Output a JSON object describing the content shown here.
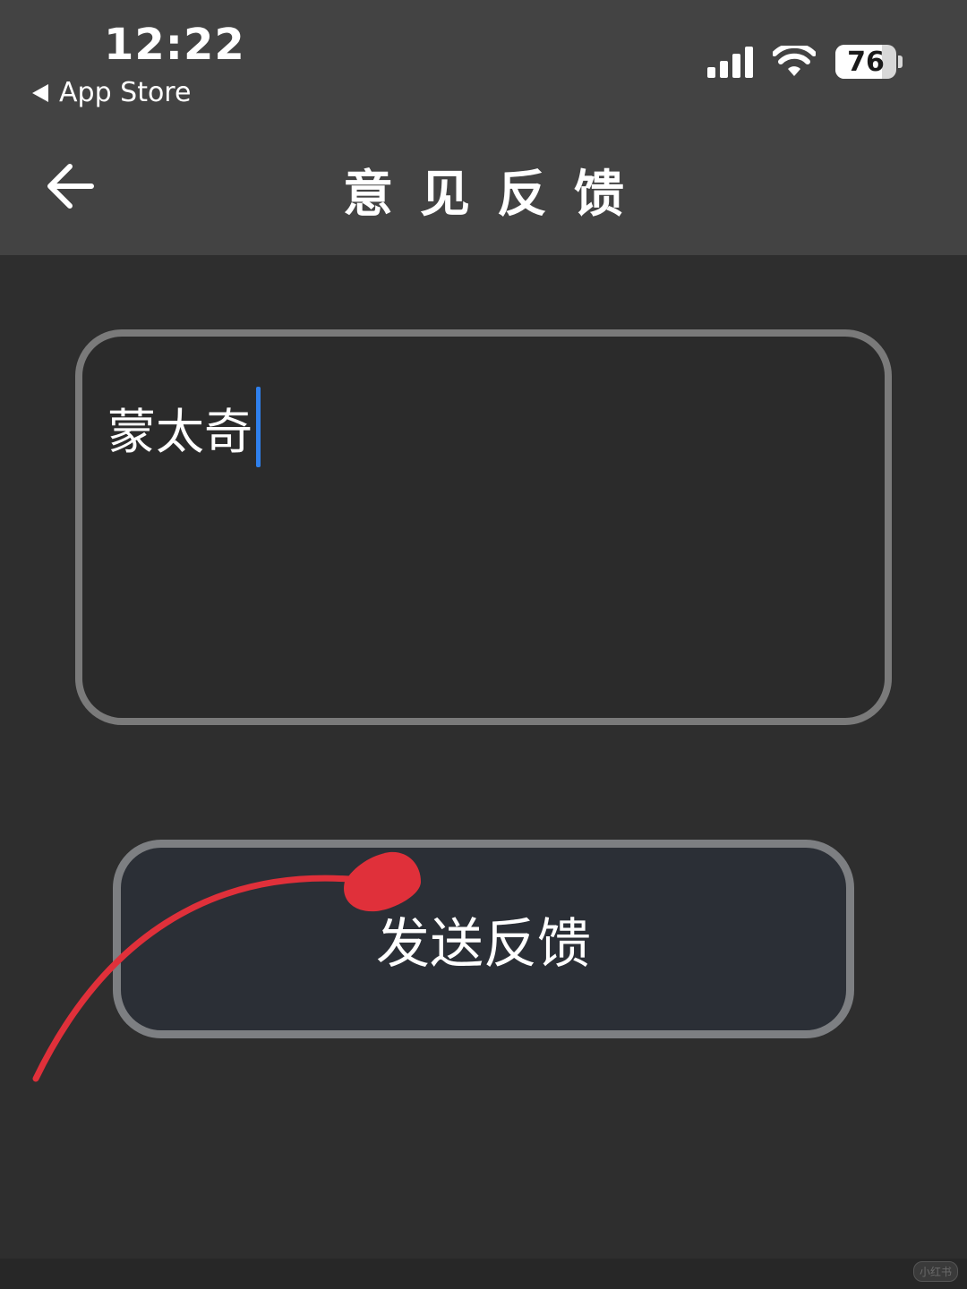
{
  "status_bar": {
    "time": "12:22",
    "back_app": "App Store",
    "battery_level": 76,
    "battery_text": "76",
    "signal_bars": 4,
    "wifi_icon": "wifi-icon",
    "signal_icon": "cellular-signal-icon",
    "battery_icon": "battery-icon"
  },
  "header": {
    "title": "意见反馈",
    "back_icon": "arrow-left-icon"
  },
  "feedback": {
    "value": "蒙太奇",
    "caret_color": "#2f80ed"
  },
  "submit": {
    "label": "发送反馈"
  },
  "annotation": {
    "type": "hand-drawn red arrow pointing to submit button",
    "color": "#e0303a"
  },
  "watermark": {
    "text": "小红书"
  },
  "colors": {
    "background": "#2e2e2e",
    "header_background": "#434343",
    "border": "#7a7a7a",
    "button_fill": "#2b2f36"
  }
}
